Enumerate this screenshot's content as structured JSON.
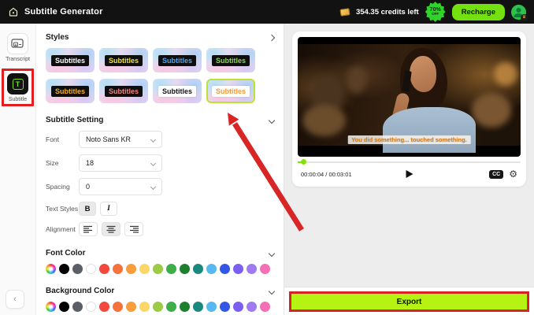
{
  "header": {
    "app_title": "Subtitle Generator",
    "credits_text": "354.35 credits left",
    "discount_percent": "70%",
    "discount_label": "OFF",
    "recharge_label": "Recharge"
  },
  "sidebar": {
    "transcript_label": "Transcript",
    "subtitle_label": "Subtitle",
    "subtitle_icon_letter": "T",
    "collapse_glyph": "‹"
  },
  "styles_section": {
    "title": "Styles",
    "tiles": [
      {
        "text": "Subtitles",
        "text_color": "#ffffff",
        "chip_bg": "#0e0e0e",
        "selected": false
      },
      {
        "text": "Subtitles",
        "text_color": "#f3e53c",
        "chip_bg": "#0e0e0e",
        "selected": false
      },
      {
        "text": "Subtitles",
        "text_color": "#51a8f5",
        "chip_bg": "#0e0e0e",
        "selected": false
      },
      {
        "text": "Subtitles",
        "text_color": "#8fd654",
        "chip_bg": "#0e0e0e",
        "selected": false
      },
      {
        "text": "Subtitles",
        "text_color": "#f5b029",
        "chip_bg": "#0e0e0e",
        "selected": false
      },
      {
        "text": "Subtitles",
        "text_color": "#ef8585",
        "chip_bg": "#0e0e0e",
        "selected": false
      },
      {
        "text": "Subtitles",
        "text_color": "#141414",
        "chip_bg": "#ffffff",
        "selected": false
      },
      {
        "text": "Subtitles",
        "text_color": "#f29b3d",
        "chip_bg": "#ffffff",
        "selected": true
      }
    ]
  },
  "subtitle_setting": {
    "title": "Subtitle Setting",
    "font_label": "Font",
    "font_value": "Noto Sans KR",
    "size_label": "Size",
    "size_value": "18",
    "spacing_label": "Spacing",
    "spacing_value": "0",
    "text_styles_label": "Text Styles",
    "bold_label": "B",
    "italic_label": "I",
    "alignment_label": "Alignment"
  },
  "font_color": {
    "title": "Font Color",
    "swatches": [
      "wheel",
      "#000000",
      "#5c6066",
      "#ffffff",
      "#f2483e",
      "#f4733c",
      "#f79d3c",
      "#fbd668",
      "#9ccb44",
      "#3fae49",
      "#207f2f",
      "#19897e",
      "#58b9f1",
      "#3356e4",
      "#7a5ff2",
      "#9e7cf0",
      "#f270b3"
    ]
  },
  "background_color": {
    "title": "Background Color",
    "swatches": [
      "wheel",
      "#000000",
      "#5c6066",
      "#ffffff",
      "#f2483e",
      "#f4733c",
      "#f79d3c",
      "#fbd668",
      "#9ccb44",
      "#3fae49",
      "#207f2f",
      "#19897e",
      "#58b9f1",
      "#3356e4",
      "#7a5ff2",
      "#9e7cf0",
      "#f270b3"
    ]
  },
  "player": {
    "subtitle_overlay": "You did something... touched something.",
    "timestamp": "00:00:04 / 00:03:01",
    "cc_label": "CC"
  },
  "export": {
    "label": "Export"
  },
  "colors": {
    "accent_green": "#74e00f",
    "export_green": "#b6f313",
    "annotation_red": "#d92525",
    "selected_tile_border": "#b8e530",
    "subtitle_text_orange": "#d9801f"
  }
}
